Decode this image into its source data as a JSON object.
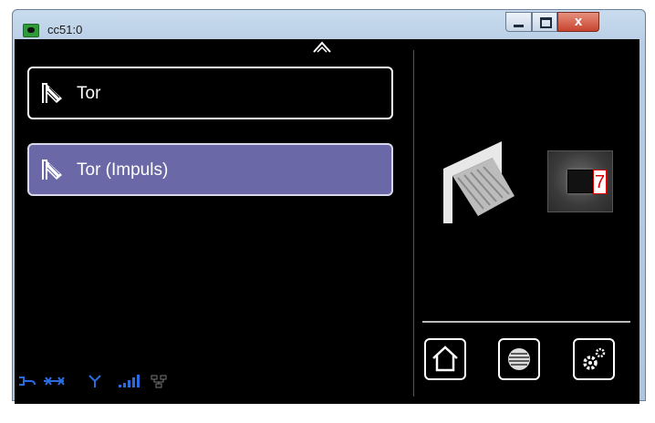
{
  "window": {
    "title": "cc51:0",
    "close_label": "x"
  },
  "list": {
    "items": [
      {
        "label": "Tor",
        "selected": false
      },
      {
        "label": "Tor (Impuls)",
        "selected": true
      }
    ]
  },
  "detail": {
    "badge": "7"
  },
  "nav": {
    "icons": [
      "home-icon",
      "blind-icon",
      "settings-icon"
    ]
  },
  "status_bar": {
    "icons": [
      "plug-icon",
      "connection-icon",
      "antenna-icon",
      "signal-icon",
      "network-icon"
    ],
    "color": "#2b6be0"
  },
  "colors": {
    "selected_item": "#6a68a6",
    "background": "#000000",
    "badge": "#e00000"
  }
}
